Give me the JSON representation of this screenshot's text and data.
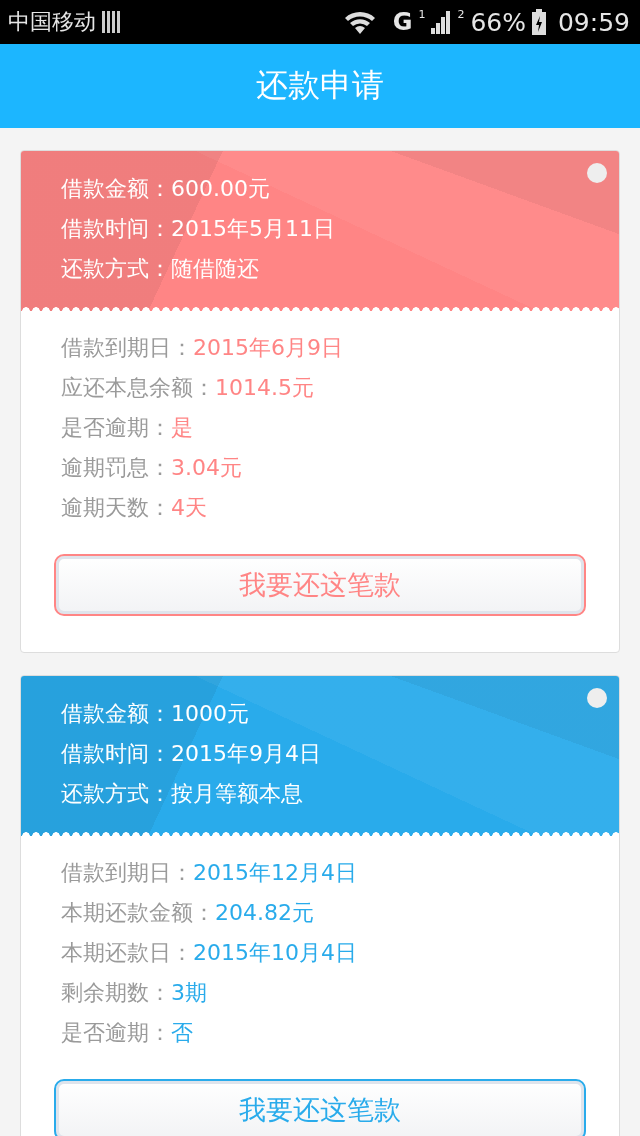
{
  "status_bar": {
    "carrier": "中国移动",
    "network_type": "G",
    "sim1": "1",
    "sim2": "2",
    "battery": "66%",
    "time": "09:59"
  },
  "header": {
    "title": "还款申请"
  },
  "loans": [
    {
      "color": "#ff8585",
      "selected": false,
      "summary": [
        {
          "label": "借款金额：",
          "value": "600.00元"
        },
        {
          "label": "借款时间：",
          "value": "2015年5月11日"
        },
        {
          "label": "还款方式：",
          "value": "随借随还"
        }
      ],
      "details": [
        {
          "label": "借款到期日：",
          "value": "2015年6月9日"
        },
        {
          "label": "应还本息余额：",
          "value": "1014.5元"
        },
        {
          "label": "是否逾期：",
          "value": "是"
        },
        {
          "label": "逾期罚息：",
          "value": "3.04元"
        },
        {
          "label": "逾期天数：",
          "value": "4天"
        }
      ],
      "button": "我要还这笔款"
    },
    {
      "color": "#29abeb",
      "selected": false,
      "summary": [
        {
          "label": "借款金额：",
          "value": "1000元"
        },
        {
          "label": "借款时间：",
          "value": "2015年9月4日"
        },
        {
          "label": "还款方式：",
          "value": "按月等额本息"
        }
      ],
      "details": [
        {
          "label": "借款到期日：",
          "value": "2015年12月4日"
        },
        {
          "label": "本期还款金额：",
          "value": "204.82元"
        },
        {
          "label": "本期还款日：",
          "value": "2015年10月4日"
        },
        {
          "label": "剩余期数：",
          "value": "3期"
        },
        {
          "label": "是否逾期：",
          "value": "否"
        }
      ],
      "button": "我要还这笔款"
    }
  ]
}
